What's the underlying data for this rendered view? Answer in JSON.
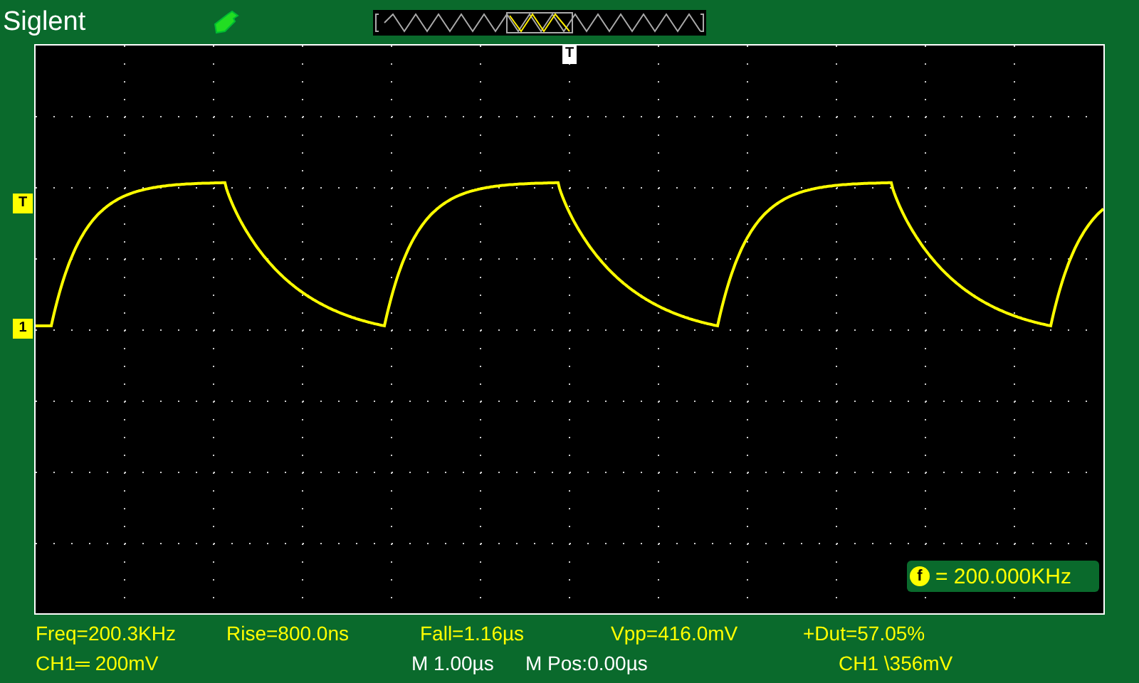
{
  "brand": "Siglent",
  "trigger_position_marker": "T",
  "trigger_level_marker": "T",
  "channel_marker": "1",
  "frequency_counter": {
    "icon": "f",
    "value": "= 200.000KHz"
  },
  "measurements": [
    "Freq=200.3KHz",
    "Rise=800.0ns",
    "Fall=1.16µs",
    "Vpp=416.0mV",
    "+Dut=57.05%"
  ],
  "status": [
    {
      "text": "CH1═ 200mV",
      "color": "#ffff00"
    },
    {
      "text": "M 1.00µs",
      "color": "#ffffff"
    },
    {
      "text": "M Pos:0.00µs",
      "color": "#ffffff"
    },
    {
      "text": "CH1 \\356mV",
      "color": "#ffff00"
    }
  ]
}
